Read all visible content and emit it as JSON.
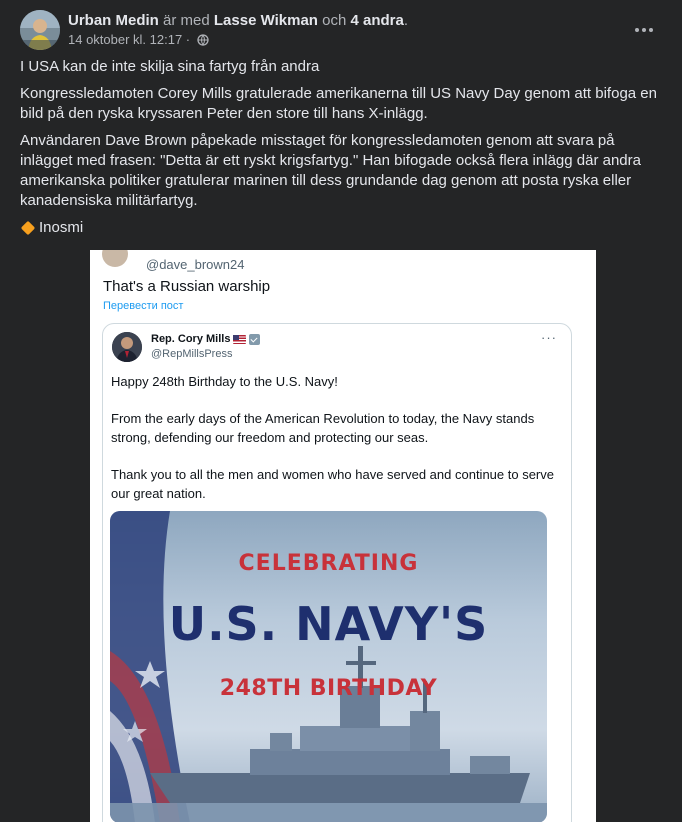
{
  "post": {
    "author": "Urban Medin",
    "with_text": " är med ",
    "tagged": "Lasse Wikman",
    "and_text": " och ",
    "others": "4 andra",
    "period": ".",
    "timestamp": "14 oktober kl. 12:17 ·",
    "paragraphs": [
      "I USA kan de inte skilja sina fartyg från andra",
      "Kongressledamoten Corey Mills gratulerade amerikanerna till US Navy Day genom att bifoga en bild på den ryska kryssaren Peter den store till hans X-inlägg.",
      "Användaren Dave Brown påpekade misstaget för kongressledamoten genom att svara på inlägget med frasen: \"Detta är ett ryskt krigsfartyg.\" Han bifogade också flera inlägg där andra amerikanska politiker gratulerar marinen till dess grundande dag genom att posta ryska eller kanadensiska militärfartyg."
    ],
    "source": "Inosmi"
  },
  "screenshot": {
    "reply": {
      "handle": "@dave_brown24",
      "text": "That's a Russian warship",
      "translate": "Перевести пост"
    },
    "quoted": {
      "name": "Rep. Cory Mills",
      "handle": "@RepMillsPress",
      "more": "···",
      "body": [
        "Happy 248th Birthday to the U.S. Navy!",
        "From the early days of the American Revolution to today, the Navy stands strong, defending our freedom and protecting our seas.",
        "Thank you to all the men and women who have served and continue to serve our great nation."
      ],
      "media": {
        "line1": "CELEBRATING",
        "line2": "U.S. NAVY'S",
        "line3": "248TH BIRTHDAY"
      }
    }
  },
  "colors": {
    "fb_bg": "#242526",
    "fb_text": "#e4e6eb",
    "fb_secondary": "#b0b3b8",
    "link_blue": "#1d9bf0",
    "navy": "#1e2f6e",
    "red": "#c8323a"
  }
}
